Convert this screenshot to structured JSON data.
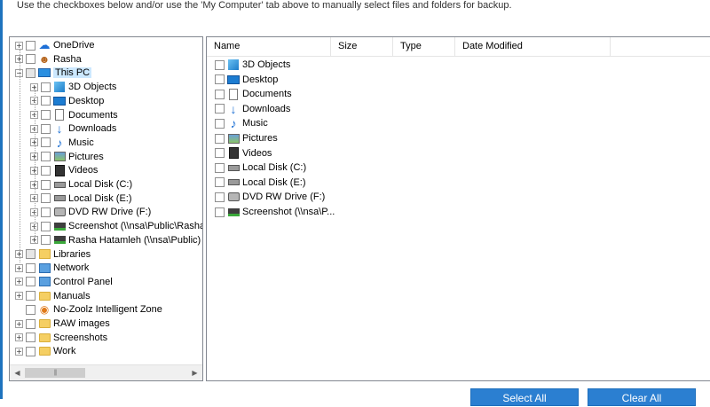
{
  "instruction": "Use the checkboxes below and/or use the 'My Computer' tab above to manually select files and folders for backup.",
  "tree": [
    {
      "label": "OneDrive",
      "icon": "cloud-icon",
      "level": 0,
      "expander": "+"
    },
    {
      "label": "Rasha",
      "icon": "user-icon",
      "level": 0,
      "expander": "+"
    },
    {
      "label": "This PC",
      "icon": "computer-icon",
      "level": 0,
      "expander": "-",
      "selected": true
    },
    {
      "label": "3D Objects",
      "icon": "3d-objects-icon",
      "level": 1,
      "expander": "+"
    },
    {
      "label": "Desktop",
      "icon": "desktop-icon",
      "level": 1,
      "expander": "+"
    },
    {
      "label": "Documents",
      "icon": "documents-icon",
      "level": 1,
      "expander": "+"
    },
    {
      "label": "Downloads",
      "icon": "downloads-icon",
      "level": 1,
      "expander": "+"
    },
    {
      "label": "Music",
      "icon": "music-icon",
      "level": 1,
      "expander": "+"
    },
    {
      "label": "Pictures",
      "icon": "pictures-icon",
      "level": 1,
      "expander": "+"
    },
    {
      "label": "Videos",
      "icon": "videos-icon",
      "level": 1,
      "expander": "+"
    },
    {
      "label": "Local Disk (C:)",
      "icon": "local-disk-icon",
      "level": 1,
      "expander": "+"
    },
    {
      "label": "Local Disk (E:)",
      "icon": "local-disk-icon",
      "level": 1,
      "expander": "+"
    },
    {
      "label": "DVD RW Drive (F:)",
      "icon": "dvd-drive-icon",
      "level": 1,
      "expander": "+"
    },
    {
      "label": "Screenshot (\\\\nsa\\Public\\Rasha",
      "icon": "network-drive-icon",
      "level": 1,
      "expander": "+"
    },
    {
      "label": "Rasha Hatamleh (\\\\nsa\\Public) (",
      "icon": "network-drive-icon",
      "level": 1,
      "expander": "+"
    },
    {
      "label": "Libraries",
      "icon": "libraries-icon",
      "level": 0,
      "expander": "+"
    },
    {
      "label": "Network",
      "icon": "network-icon",
      "level": 0,
      "expander": "+"
    },
    {
      "label": "Control Panel",
      "icon": "control-panel-icon",
      "level": 0,
      "expander": "+"
    },
    {
      "label": "Manuals",
      "icon": "folder-icon",
      "level": 0,
      "expander": "+"
    },
    {
      "label": "No-Zoolz Intelligent Zone",
      "icon": "zone-icon",
      "level": 0,
      "expander": ""
    },
    {
      "label": "RAW images",
      "icon": "folder-icon",
      "level": 0,
      "expander": "+"
    },
    {
      "label": "Screenshots",
      "icon": "folder-icon",
      "level": 0,
      "expander": "+"
    },
    {
      "label": "Work",
      "icon": "folder-icon",
      "level": 0,
      "expander": "+"
    }
  ],
  "list_columns": [
    "Name",
    "Size",
    "Type",
    "Date Modified"
  ],
  "files": [
    {
      "label": "3D Objects",
      "icon": "3d-objects-icon"
    },
    {
      "label": "Desktop",
      "icon": "desktop-icon"
    },
    {
      "label": "Documents",
      "icon": "documents-icon"
    },
    {
      "label": "Downloads",
      "icon": "downloads-icon"
    },
    {
      "label": "Music",
      "icon": "music-icon"
    },
    {
      "label": "Pictures",
      "icon": "pictures-icon"
    },
    {
      "label": "Videos",
      "icon": "videos-icon"
    },
    {
      "label": "Local Disk (C:)",
      "icon": "local-disk-icon"
    },
    {
      "label": "Local Disk (E:)",
      "icon": "local-disk-icon"
    },
    {
      "label": "DVD RW Drive (F:)",
      "icon": "dvd-drive-icon"
    },
    {
      "label": "Screenshot (\\\\nsa\\P...",
      "icon": "network-drive-icon"
    }
  ],
  "buttons": {
    "select_all": "Select All",
    "clear_all": "Clear All"
  },
  "colors": {
    "accent": "#2b7fd1",
    "selection": "#cce8ff",
    "frame": "#1e73be"
  }
}
